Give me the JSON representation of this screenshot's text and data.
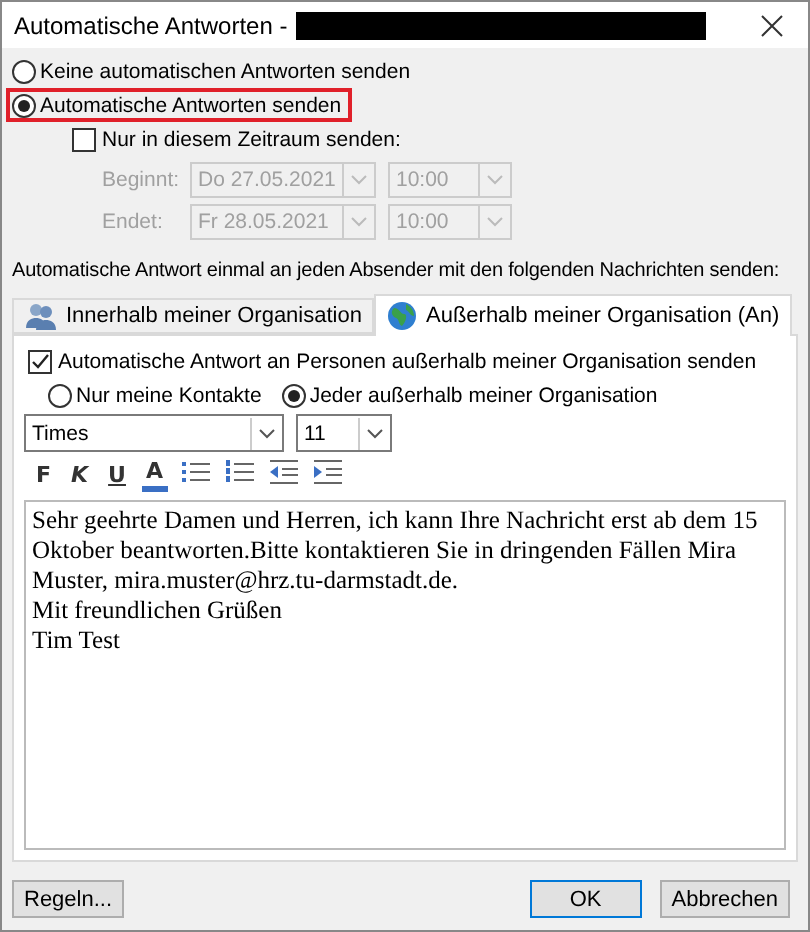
{
  "window": {
    "title": "Automatische Antworten -",
    "redacted": true
  },
  "reply_mode": [
    {
      "label": "Keine automatischen Antworten senden",
      "selected": false,
      "highlighted": false
    },
    {
      "label": "Automatische Antworten senden",
      "selected": true,
      "highlighted": true
    }
  ],
  "period": {
    "label": "Nur in diesem Zeitraum senden:",
    "checked": false,
    "disabled": true,
    "rows": [
      {
        "label": "Beginnt:",
        "date": "Do 27.05.2021",
        "time": "10:00"
      },
      {
        "label": "Endet:",
        "date": "Fr 28.05.2021",
        "time": "10:00"
      }
    ]
  },
  "instruction": "Automatische Antwort einmal an jeden Absender mit den folgenden Nachrichten senden:",
  "tabs": [
    {
      "label": "Innerhalb meiner Organisation",
      "selected": false,
      "kind": "people"
    },
    {
      "label": "Außerhalb meiner Organisation (An)",
      "selected": true,
      "kind": "globe"
    }
  ],
  "outside": {
    "send": {
      "label": "Automatische Antwort an Personen außerhalb meiner Organisation senden",
      "checked": true
    },
    "audience": [
      {
        "label": "Nur meine Kontakte",
        "selected": false
      },
      {
        "label": "Jeder außerhalb meiner Organisation",
        "selected": true
      }
    ],
    "font": "Times",
    "size": "11",
    "format": [
      {
        "kind": "bold",
        "label": "F"
      },
      {
        "kind": "italic",
        "label": "K"
      },
      {
        "kind": "underline",
        "label": "U"
      },
      {
        "kind": "color",
        "label": "A"
      },
      {
        "kind": "bullets"
      },
      {
        "kind": "numbers"
      },
      {
        "kind": "outdent"
      },
      {
        "kind": "indent"
      }
    ],
    "message": [
      "Sehr geehrte Damen und Herren, ich kann Ihre Nachricht erst ab dem 15 Oktober beantworten.Bitte kontaktieren Sie in dringenden Fällen Mira Muster, mira.muster@hrz.tu-darmstadt.de.",
      "Mit freundlichen Grüßen",
      "Tim Test"
    ]
  },
  "buttons": [
    {
      "label": "Regeln...",
      "kind": "rules"
    },
    {
      "label": "OK",
      "kind": "default"
    },
    {
      "label": "Abbrechen",
      "kind": "cancel"
    }
  ]
}
